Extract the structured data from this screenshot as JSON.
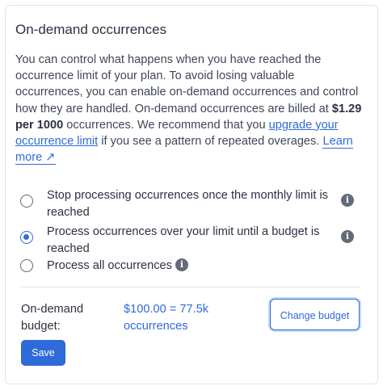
{
  "section": {
    "title": "On-demand occurrences",
    "description": {
      "part1": "You can control what happens when you have reached the occurrence limit of your plan. To avoid losing valuable occurrences, you can enable on-demand occurrences and control how they are handled. On-demand occurrences are billed at ",
      "price": "$1.29 per 1000",
      "part2": " occurrences. We recommend that you ",
      "upgrade_link": "upgrade your occurrence limit",
      "part3": " if you see a pattern of repeated overages. ",
      "learn_more_link": "Learn more ↗"
    }
  },
  "options": [
    {
      "label": "Stop processing occurrences once the monthly limit is reached",
      "selected": false,
      "info_icon": "info-icon"
    },
    {
      "label": "Process occurrences over your limit until a budget is reached",
      "selected": true,
      "info_icon": "info-icon"
    },
    {
      "label": "Process all occurrences",
      "selected": false,
      "info_icon": "info-icon"
    }
  ],
  "budget": {
    "label": "On-demand budget:",
    "value": "$100.00 = 77.5k occurrences",
    "change_button": "Change budget"
  },
  "save_button": "Save",
  "colors": {
    "accent": "#2f6bd8",
    "text": "#2b3140",
    "info_icon": "#636b78"
  }
}
